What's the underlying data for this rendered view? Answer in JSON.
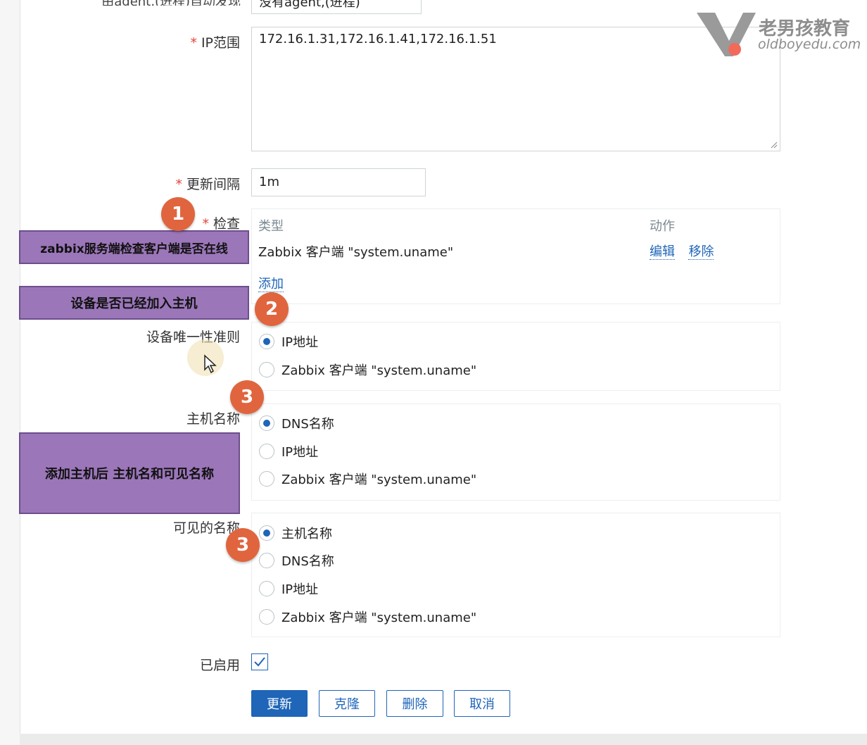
{
  "top_clipped": {
    "label": "由agent,(进程)自动发现",
    "value": "没有agent,(进程)"
  },
  "form": {
    "ip_range": {
      "label": "IP范围",
      "value": "172.16.1.31,172.16.1.41,172.16.1.51"
    },
    "update_interval": {
      "label": "更新间隔",
      "value": "1m"
    },
    "checks": {
      "label": "检查",
      "col_type": "类型",
      "col_action": "动作",
      "rows": [
        {
          "type": "Zabbix 客户端 \"system.uname\"",
          "edit": "编辑",
          "remove": "移除"
        }
      ],
      "add": "添加"
    },
    "uniqueness": {
      "label": "设备唯一性准则",
      "options": [
        "IP地址",
        "Zabbix 客户端 \"system.uname\""
      ],
      "selected": "IP地址"
    },
    "host_name": {
      "label": "主机名称",
      "options": [
        "DNS名称",
        "IP地址",
        "Zabbix 客户端 \"system.uname\""
      ],
      "selected": "DNS名称"
    },
    "visible_name": {
      "label": "可见的名称",
      "options": [
        "主机名称",
        "DNS名称",
        "IP地址",
        "Zabbix 客户端 \"system.uname\""
      ],
      "selected": "主机名称"
    },
    "enabled": {
      "label": "已启用",
      "checked": true
    }
  },
  "buttons": {
    "update": "更新",
    "clone": "克隆",
    "delete": "删除",
    "cancel": "取消"
  },
  "annotations": {
    "box1": "zabbix服务端检查客户端是否在线",
    "box2": "设备是否已经加入主机",
    "box3": "添加主机后 主机名和可见名称",
    "badge1": "1",
    "badge2": "2",
    "badge3a": "3",
    "badge3b": "3"
  },
  "watermark": {
    "name": "老男孩教育",
    "url": "oldboyedu.com"
  },
  "colors": {
    "accent": "#1f65b8",
    "required": "#e0463b",
    "annotation_purple": "#9b76b9",
    "badge": "#e0653e"
  }
}
